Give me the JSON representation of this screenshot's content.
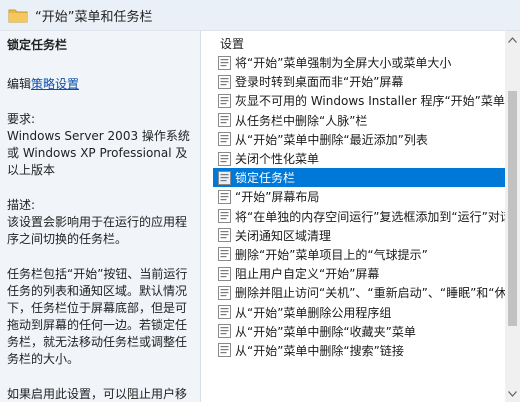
{
  "window": {
    "title": "“开始”菜单和任务栏"
  },
  "left_pane": {
    "heading": "锁定任务栏",
    "edit_prefix": "编辑",
    "edit_link": "策略设置",
    "requirements_label": "要求:",
    "requirements_text": "Windows Server 2003 操作系统或 Windows XP Professional 及以上版本",
    "description_label": "描述:",
    "description_text": "该设置会影响用于在运行的应用程序之间切换的任务栏。",
    "taskbar_text": "任务栏包括“开始”按钮、当前运行任务的列表和通知区域。默认情况下，任务栏位于屏幕底部，但是可拖动到屏幕的任何一边。若锁定任务栏，就无法移动任务栏或调整任务栏的大小。",
    "enable_text": "如果启用此设置，可以阻止用户移动任务栏或调整任务栏的大小。如"
  },
  "right_pane": {
    "column_header": "设置",
    "selected_index": 7,
    "items": [
      {
        "label": "将“开始”菜单强制为全屏大小或菜单大小"
      },
      {
        "label": "登录时转到桌面而非“开始”屏幕"
      },
      {
        "label": "灰显不可用的 Windows Installer 程序“开始”菜单"
      },
      {
        "label": "从任务栏中删除“人脉”栏"
      },
      {
        "label": "从“开始”菜单中删除“最近添加”列表"
      },
      {
        "label": "关闭个性化菜单"
      },
      {
        "label": "锁定任务栏"
      },
      {
        "label": "“开始”屏幕布局"
      },
      {
        "label": "将“在单独的内存空间运行”复选框添加到“运行”对话"
      },
      {
        "label": "关闭通知区域清理"
      },
      {
        "label": "删除“开始”菜单项目上的“气球提示”"
      },
      {
        "label": "阻止用户自定义“开始”屏幕"
      },
      {
        "label": "删除并阻止访问“关机”、“重新启动”、“睡眠”和“休"
      },
      {
        "label": "从“开始”菜单删除公用程序组"
      },
      {
        "label": "从“开始”菜单中删除“收藏夹”菜单"
      },
      {
        "label": "从“开始”菜单中删除“搜索”链接"
      }
    ]
  },
  "icons": {
    "folder": "folder-icon",
    "policy": "policy-setting-icon",
    "scroll_up": "chevron-up-icon",
    "scroll_down": "chevron-down-icon"
  },
  "colors": {
    "selection": "#0078d7",
    "left_pane_bg": "#f1f4f9",
    "link": "#0b4fa8",
    "folder": "#e8b84a"
  }
}
